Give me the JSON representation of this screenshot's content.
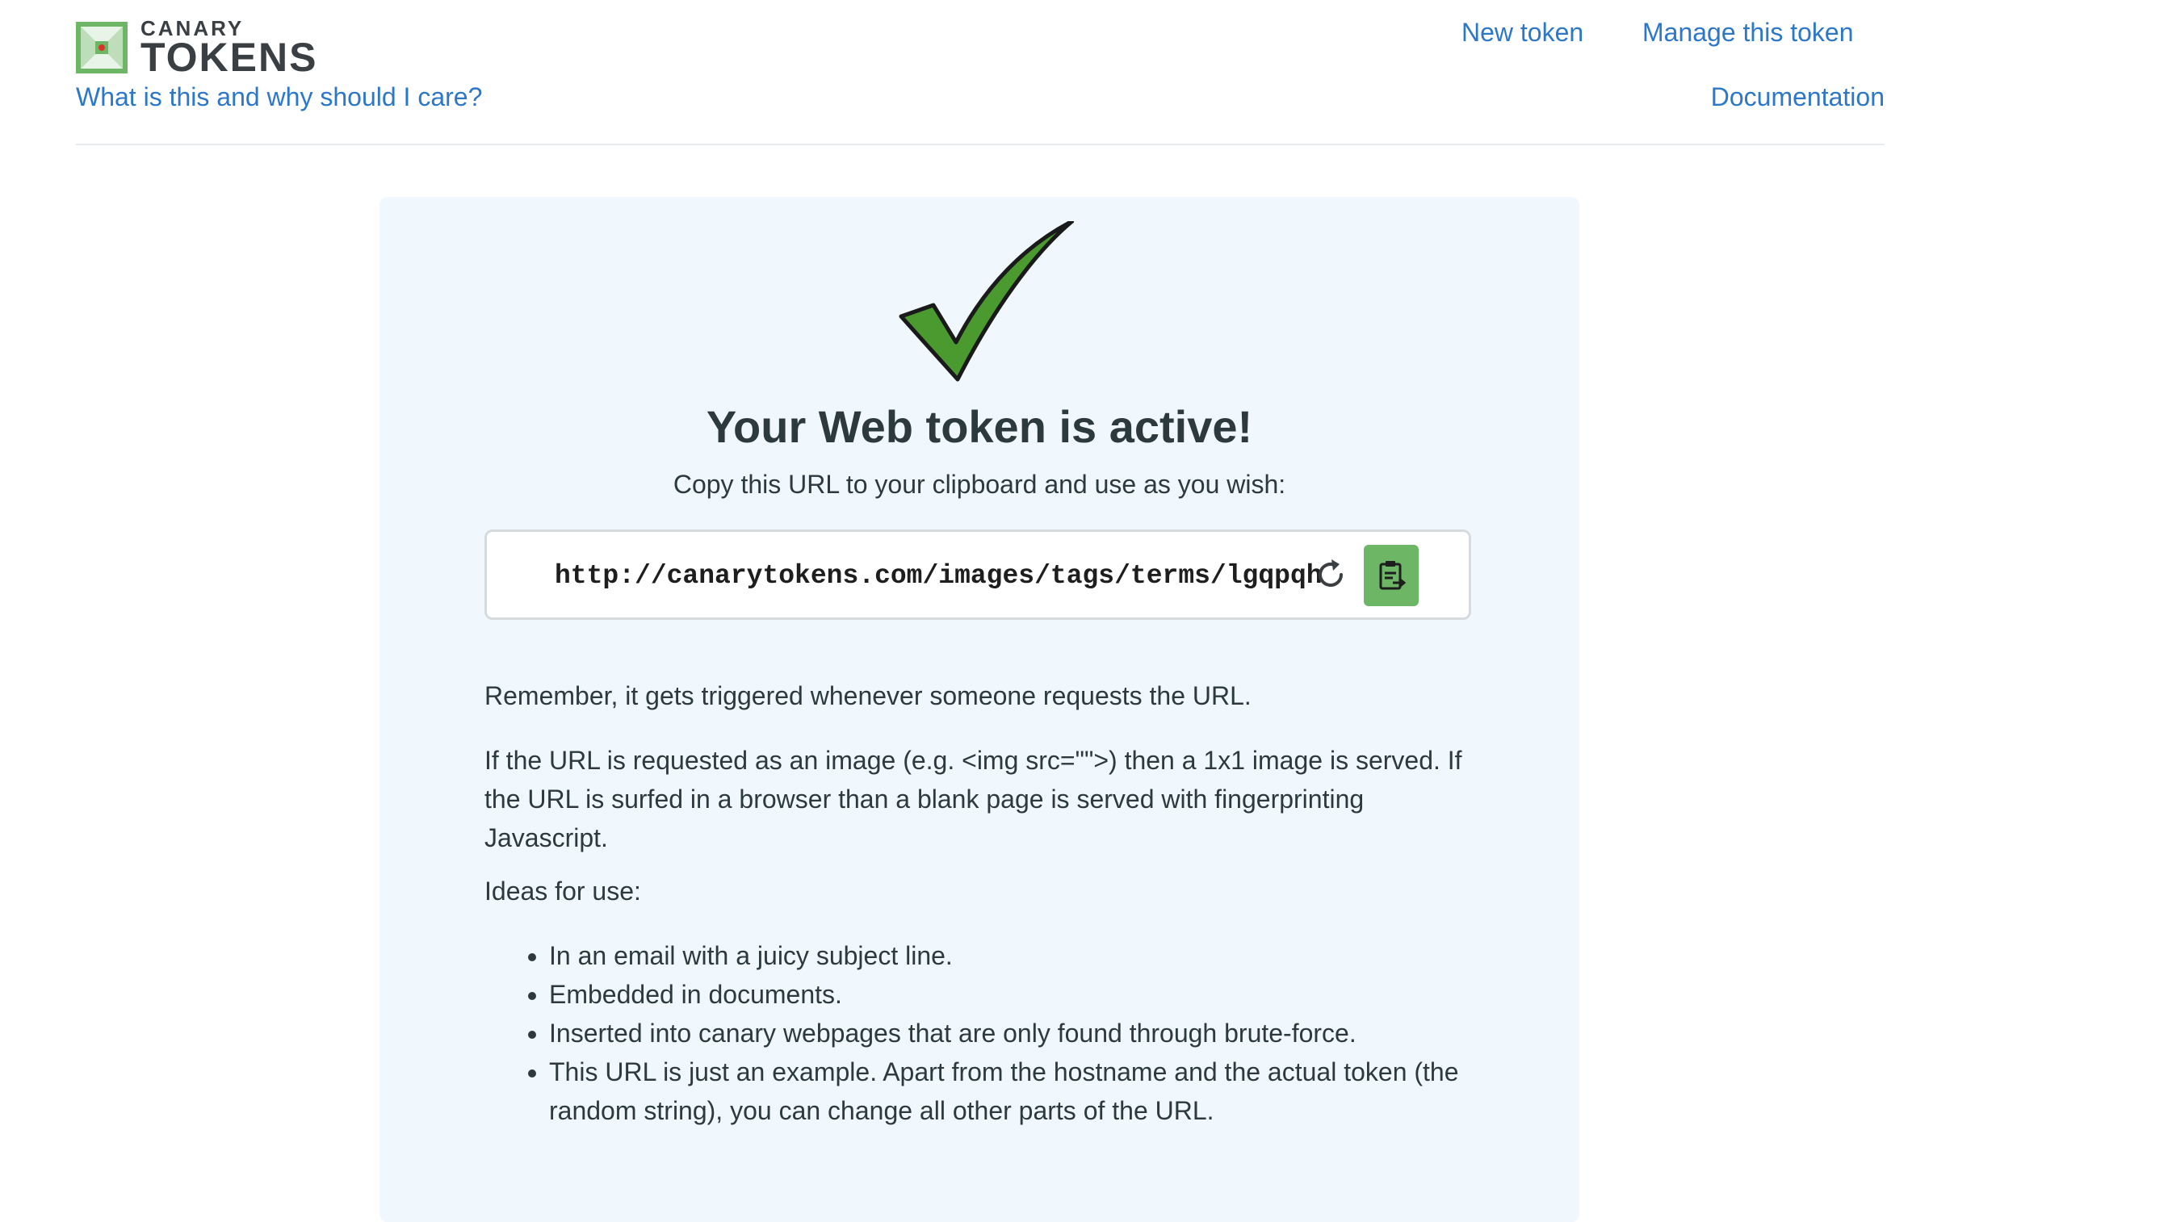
{
  "brand": {
    "top": "CANARY",
    "bottom": "TOKENS",
    "color": "#6db665"
  },
  "nav": {
    "what_link": "What is this and why should I care?",
    "new_token": "New token",
    "manage_token": "Manage this token",
    "documentation": "Documentation"
  },
  "card": {
    "title": "Your Web token is active!",
    "subtitle": "Copy this URL to your clipboard and use as you wish:",
    "url": "http://canarytokens.com/images/tags/terms/lgqpqh",
    "refresh_icon": "refresh-icon",
    "copy_icon": "clipboard-icon",
    "paragraph1": "Remember, it gets triggered whenever someone requests the URL.",
    "paragraph2": "If the URL is requested as an image (e.g. <img src=\"\">) then a 1x1 image is served. If the URL is surfed in a browser than a blank page is served with fingerprinting Javascript.",
    "ideas_label": "Ideas for use:",
    "ideas": [
      "In an email with a juicy subject line.",
      "Embedded in documents.",
      "Inserted into canary webpages that are only found through brute-force.",
      "This URL is just an example. Apart from the hostname and the actual token (the random string), you can change all other parts of the URL."
    ]
  },
  "colors": {
    "link": "#2d77c9",
    "card_bg": "#f0f7fd",
    "check_green": "#4a9a2f",
    "copy_button": "#6cb665"
  }
}
